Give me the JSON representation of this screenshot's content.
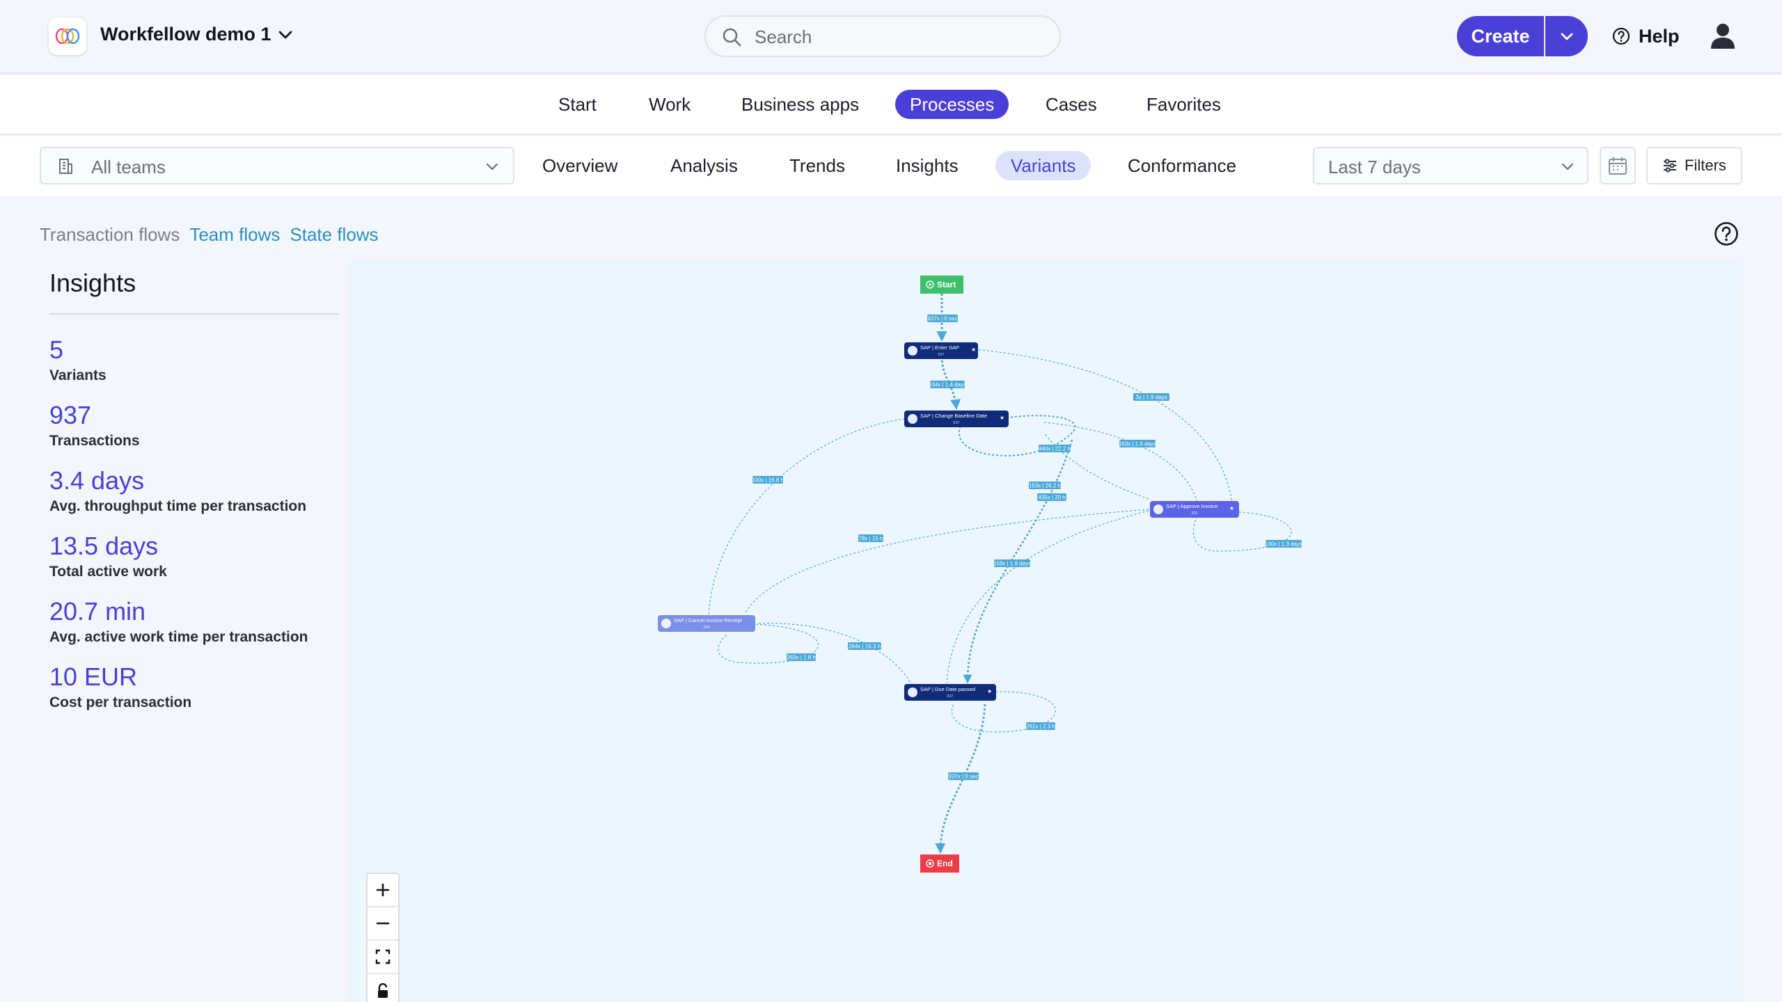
{
  "header": {
    "workspace_name": "Workfellow demo 1",
    "search_placeholder": "Search",
    "create_label": "Create",
    "help_label": "Help"
  },
  "main_nav": [
    {
      "label": "Start",
      "active": false
    },
    {
      "label": "Work",
      "active": false
    },
    {
      "label": "Business apps",
      "active": false
    },
    {
      "label": "Processes",
      "active": true
    },
    {
      "label": "Cases",
      "active": false
    },
    {
      "label": "Favorites",
      "active": false
    }
  ],
  "sub_nav": {
    "teams_label": "All teams",
    "tabs": [
      {
        "label": "Overview",
        "active": false
      },
      {
        "label": "Analysis",
        "active": false
      },
      {
        "label": "Trends",
        "active": false
      },
      {
        "label": "Insights",
        "active": false
      },
      {
        "label": "Variants",
        "active": true
      },
      {
        "label": "Conformance",
        "active": false
      }
    ],
    "range_label": "Last 7 days",
    "filters_label": "Filters"
  },
  "flow_links": {
    "transaction": "Transaction flows",
    "team": "Team flows",
    "state": "State flows"
  },
  "insights": {
    "title": "Insights",
    "metrics": [
      {
        "value": "5",
        "label": "Variants"
      },
      {
        "value": "937",
        "label": "Transactions"
      },
      {
        "value": "3.4 days",
        "label": "Avg. throughput time per transaction"
      },
      {
        "value": "13.5 days",
        "label": "Total active work"
      },
      {
        "value": "20.7 min",
        "label": "Avg. active work time per transaction"
      },
      {
        "value": "10 EUR",
        "label": "Cost per transaction"
      }
    ]
  },
  "process_map": {
    "start_label": "Start",
    "end_label": "End",
    "nodes": [
      {
        "id": "enter",
        "title": "SAP | Enter SAP",
        "count": "937"
      },
      {
        "id": "change",
        "title": "SAP | Change Baseline Date",
        "count": "937"
      },
      {
        "id": "approve",
        "title": "SAP | Approve Invoice",
        "count": "322"
      },
      {
        "id": "cancel",
        "title": "SAP | Cancel Invoice Receipt",
        "count": "264"
      },
      {
        "id": "due",
        "title": "SAP | Due Date passed",
        "count": "937"
      }
    ],
    "edge_labels": [
      "937x | 0 sec",
      "934x | 1.4 days",
      "3x | 1.9 days",
      "100x | 16.8 h",
      "440x | 22.2 h",
      "163x | 1.6 days",
      "153x | 26.2 h",
      "435x | 20 h",
      "78x | 15 h",
      "159x | 1.9 days",
      "130x | 1.3 days",
      "264x | 16.3 h",
      "283x | 1.8 h",
      "261x | 2.3 h",
      "937x | 0 sec"
    ],
    "colors": {
      "start": "#3fbf6a",
      "end": "#ee3c47",
      "node": "#0f2b7a",
      "node_light": "#7a8fe8",
      "edge": "#4aa8d8",
      "label_bg": "#4aa8d8"
    }
  }
}
